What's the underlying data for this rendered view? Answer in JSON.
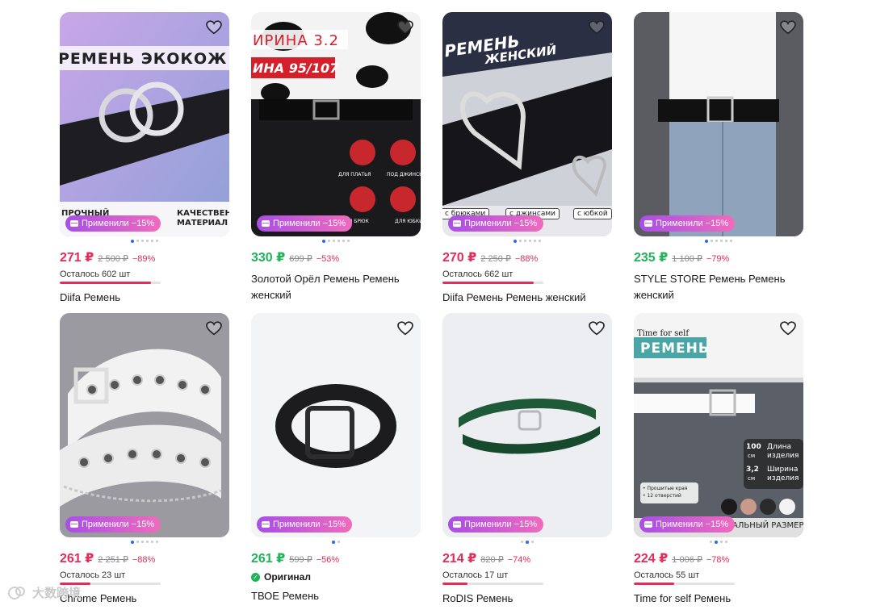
{
  "promo_label": "Применили −15%",
  "products": [
    {
      "image": {
        "type": "rings-belt",
        "banner_top": "РЕМЕНЬ ЭКОКОЖ",
        "bottom_left": "ПРОЧНЫЙ",
        "bottom_right": "КАЧЕСТВЕН\nМАТЕРИАЛ"
      },
      "price": "271 ₽",
      "price_color": "red",
      "old_price": "2 500 ₽",
      "discount": "−89%",
      "stock": "Осталось 602 шт",
      "stock_level": 0.9,
      "title": "Diifa Ремень",
      "dots": 6,
      "active_dot": 0
    },
    {
      "image": {
        "type": "cow-shirt",
        "banner_top": "ИРИНА  3.2",
        "banner_red": "ИНА 95/107",
        "icons": [
          "ДЛЯ ПЛАТЬЯ",
          "ПОД ДЖИНСЫ",
          "ДЛЯ БРЮК",
          "ДЛЯ ЮБКИ"
        ]
      },
      "price": "330 ₽",
      "price_color": "green",
      "old_price": "699 ₽",
      "discount": "−53%",
      "title": "Золотой Орёл Ремень Ремень женский",
      "dots": 6,
      "active_dot": 0
    },
    {
      "image": {
        "type": "heart-belt",
        "banner_top": "РЕМЕНЬ",
        "banner_sub": "ЖЕНСКИЙ",
        "chips": [
          "с брюками",
          "с джинсами",
          "с юбкой"
        ]
      },
      "price": "270 ₽",
      "price_color": "red",
      "old_price": "2 250 ₽",
      "discount": "−88%",
      "stock": "Осталось 662 шт",
      "stock_level": 0.9,
      "title": "Diifa Ремень Ремень женский",
      "dots": 6,
      "active_dot": 0
    },
    {
      "image": {
        "type": "jeans-belt"
      },
      "price": "235 ₽",
      "price_color": "green",
      "old_price": "1 100 ₽",
      "discount": "−79%",
      "title": "STYLE STORE Ремень Ремень женский",
      "dots": 6,
      "active_dot": 0
    },
    {
      "image": {
        "type": "white-eyelet"
      },
      "price": "261 ₽",
      "price_color": "red",
      "old_price": "2 251 ₽",
      "discount": "−88%",
      "stock": "Осталось 23 шт",
      "stock_level": 0.3,
      "title": "Chrome Ремень",
      "dots": 6,
      "active_dot": 0
    },
    {
      "image": {
        "type": "black-belt"
      },
      "price": "261 ₽",
      "price_color": "green",
      "old_price": "599 ₽",
      "discount": "−56%",
      "badge": "Оригинал",
      "title": "ТВОЕ Ремень",
      "dots": 2,
      "active_dot": 0
    },
    {
      "image": {
        "type": "green-belt"
      },
      "price": "214 ₽",
      "price_color": "red",
      "old_price": "820 ₽",
      "discount": "−74%",
      "stock": "Осталось 17 шт",
      "stock_level": 0.25,
      "title": "RoDIS Ремень",
      "dots": 3,
      "active_dot": 1
    },
    {
      "image": {
        "type": "timeforself",
        "brand": "Time for self",
        "banner": "РЕМЕНЬ",
        "spec1_num": "100",
        "spec1_unit": "см",
        "spec1_label": "Длина\nизделия",
        "spec2_num": "3,2",
        "spec2_unit": "см",
        "spec2_label": "Ширина\nизделия",
        "note": "• Прошитые края\n• 12 отверстий",
        "size": "АЛЬНЫЙ РАЗМЕР"
      },
      "price": "224 ₽",
      "price_color": "red",
      "old_price": "1 006 ₽",
      "discount": "−78%",
      "stock": "Осталось 55 шт",
      "stock_level": 0.4,
      "title": "Time for self Ремень",
      "dots": 4,
      "active_dot": 1
    }
  ],
  "watermark": "大数跨境"
}
